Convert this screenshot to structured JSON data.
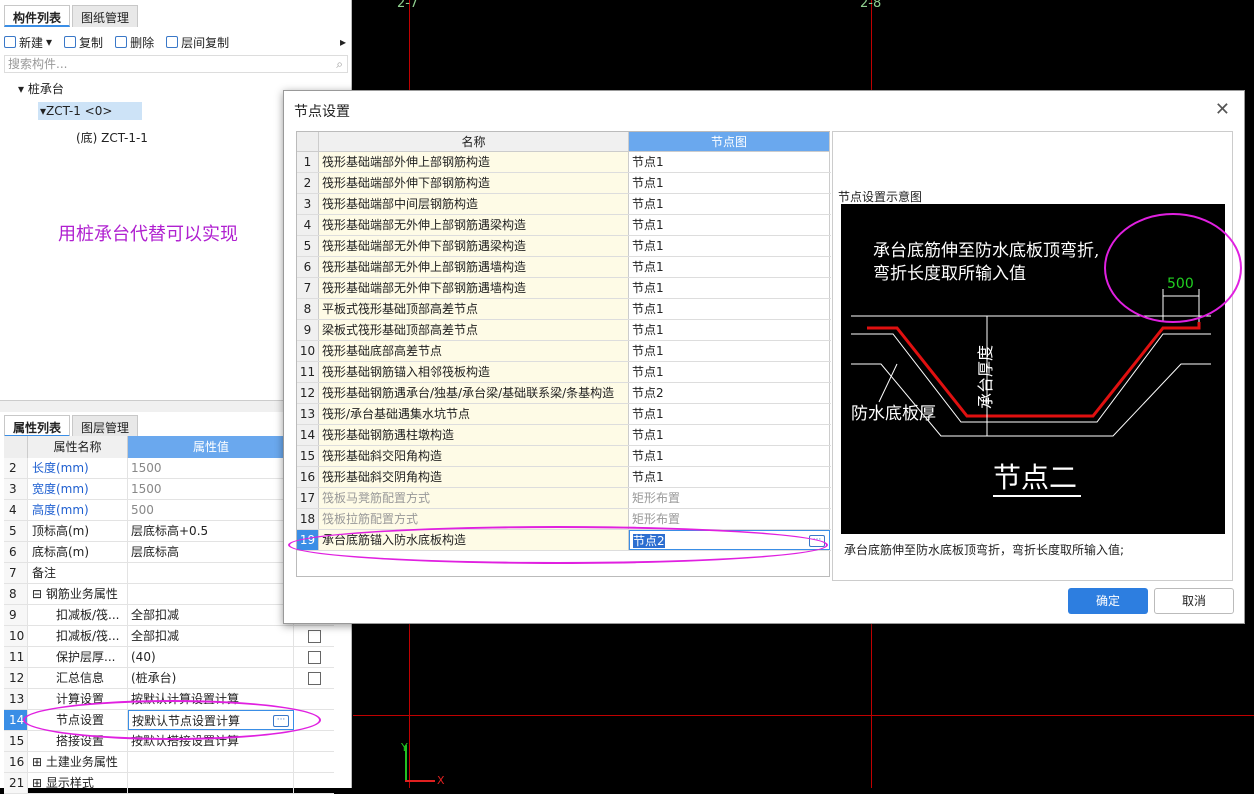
{
  "left_tabs": [
    "构件列表",
    "图纸管理"
  ],
  "toolbar": {
    "new": "新建",
    "copy": "复制",
    "delete": "删除",
    "floor_copy": "层间复制",
    "more": "▸"
  },
  "search": {
    "placeholder": "搜索构件..."
  },
  "tree": {
    "root": "桩承台",
    "item": "ZCT-1 <0>",
    "child": "(底) ZCT-1-1"
  },
  "annotation": "用桩承台代替可以实现",
  "prop_tabs": [
    "属性列表",
    "图层管理"
  ],
  "prop_header": {
    "name": "属性名称",
    "value": "属性值"
  },
  "props": [
    {
      "n": "2",
      "k": "长度(mm)",
      "v": "1500",
      "blue": true,
      "grey": true
    },
    {
      "n": "3",
      "k": "宽度(mm)",
      "v": "1500",
      "blue": true,
      "grey": true
    },
    {
      "n": "4",
      "k": "高度(mm)",
      "v": "500",
      "blue": true,
      "grey": true
    },
    {
      "n": "5",
      "k": "顶标高(m)",
      "v": "层底标高+0.5"
    },
    {
      "n": "6",
      "k": "底标高(m)",
      "v": "层底标高"
    },
    {
      "n": "7",
      "k": "备注",
      "v": ""
    },
    {
      "n": "8",
      "k": "⊟ 钢筋业务属性",
      "v": ""
    },
    {
      "n": "9",
      "k": "扣减板/筏...",
      "v": "全部扣减",
      "indent": true
    },
    {
      "n": "10",
      "k": "扣减板/筏...",
      "v": "全部扣减",
      "indent": true,
      "chk": true
    },
    {
      "n": "11",
      "k": "保护层厚...",
      "v": "(40)",
      "indent": true,
      "chk": true
    },
    {
      "n": "12",
      "k": "汇总信息",
      "v": "(桩承台)",
      "indent": true,
      "chk": true
    },
    {
      "n": "13",
      "k": "计算设置",
      "v": "按默认计算设置计算",
      "indent": true
    },
    {
      "n": "14",
      "k": "节点设置",
      "v": "按默认节点设置计算",
      "indent": true,
      "sel": true
    },
    {
      "n": "15",
      "k": "搭接设置",
      "v": "按默认搭接设置计算",
      "indent": true
    },
    {
      "n": "16",
      "k": "⊞ 土建业务属性",
      "v": ""
    },
    {
      "n": "21",
      "k": "⊞ 显示样式",
      "v": ""
    }
  ],
  "canvas": {
    "axis_labels": [
      "2-7",
      "2-8"
    ],
    "y": "Y",
    "x": "X"
  },
  "dialog": {
    "title": "节点设置",
    "close": "✕",
    "col_name": "名称",
    "col_node": "节点图",
    "rows": [
      {
        "n": "1",
        "name": "筏形基础端部外伸上部钢筋构造",
        "val": "节点1"
      },
      {
        "n": "2",
        "name": "筏形基础端部外伸下部钢筋构造",
        "val": "节点1"
      },
      {
        "n": "3",
        "name": "筏形基础端部中间层钢筋构造",
        "val": "节点1"
      },
      {
        "n": "4",
        "name": "筏形基础端部无外伸上部钢筋遇梁构造",
        "val": "节点1"
      },
      {
        "n": "5",
        "name": "筏形基础端部无外伸下部钢筋遇梁构造",
        "val": "节点1"
      },
      {
        "n": "6",
        "name": "筏形基础端部无外伸上部钢筋遇墙构造",
        "val": "节点1"
      },
      {
        "n": "7",
        "name": "筏形基础端部无外伸下部钢筋遇墙构造",
        "val": "节点1"
      },
      {
        "n": "8",
        "name": "平板式筏形基础顶部高差节点",
        "val": "节点1"
      },
      {
        "n": "9",
        "name": "梁板式筏形基础顶部高差节点",
        "val": "节点1"
      },
      {
        "n": "10",
        "name": "筏形基础底部高差节点",
        "val": "节点1"
      },
      {
        "n": "11",
        "name": "筏形基础钢筋锚入相邻筏板构造",
        "val": "节点1"
      },
      {
        "n": "12",
        "name": "筏形基础钢筋遇承台/独基/承台梁/基础联系梁/条基构造",
        "val": "节点2"
      },
      {
        "n": "13",
        "name": "筏形/承台基础遇集水坑节点",
        "val": "节点1"
      },
      {
        "n": "14",
        "name": "筏形基础钢筋遇柱墩构造",
        "val": "节点1"
      },
      {
        "n": "15",
        "name": "筏形基础斜交阳角构造",
        "val": "节点1"
      },
      {
        "n": "16",
        "name": "筏形基础斜交阴角构造",
        "val": "节点1"
      },
      {
        "n": "17",
        "name": "筏板马凳筋配置方式",
        "val": "矩形布置",
        "dim": true
      },
      {
        "n": "18",
        "name": "筏板拉筋配置方式",
        "val": "矩形布置",
        "dim": true
      },
      {
        "n": "19",
        "name": "承台底筋锚入防水底板构造",
        "val": "节点2",
        "sel": true
      }
    ],
    "preview_label": "节点设置示意图",
    "preview": {
      "line1": "承台底筋伸至防水底板顶弯折,",
      "line2": "弯折长度取所输入值",
      "dim": "500",
      "depth": "承台厚度",
      "slab": "防水底板厚",
      "node": "节点二"
    },
    "preview_desc": "承台底筋伸至防水底板顶弯折，弯折长度取所输入值;",
    "ok": "确定",
    "cancel": "取消"
  },
  "colors": {
    "accent": "#2d7ee0",
    "highlight": "#e020e0",
    "grid_red": "#c00000"
  }
}
